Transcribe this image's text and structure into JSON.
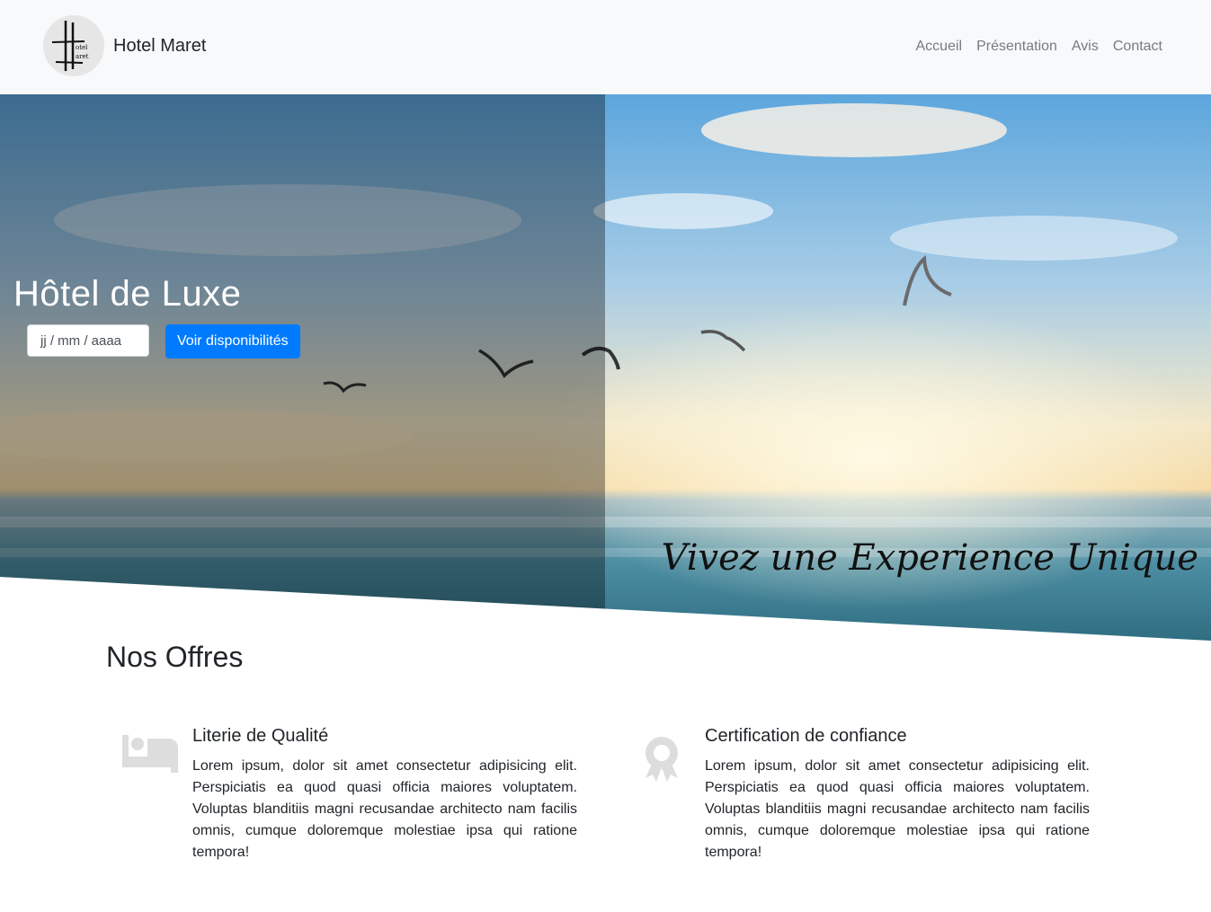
{
  "navbar": {
    "brand": "Hotel Maret",
    "logo_icon": "hotel-maret-logo",
    "links": [
      "Accueil",
      "Présentation",
      "Avis",
      "Contact"
    ]
  },
  "hero": {
    "title": "Hôtel de Luxe",
    "date_placeholder": "jj / mm / aaaa",
    "button": "Voir disponibilités",
    "tagline": "Vivez une Experience Unique"
  },
  "offers": {
    "title": "Nos Offres",
    "items": [
      {
        "icon": "bed-icon",
        "title": "Literie de Qualité",
        "text": "Lorem ipsum, dolor sit amet consectetur adipisicing elit. Perspiciatis ea quod quasi officia maiores voluptatem. Voluptas blanditiis magni recusandae architecto nam facilis omnis, cumque doloremque molestiae ipsa qui ratione tempora!"
      },
      {
        "icon": "award-icon",
        "title": "Certification de confiance",
        "text": "Lorem ipsum, dolor sit amet consectetur adipisicing elit. Perspiciatis ea quod quasi officia maiores voluptatem. Voluptas blanditiis magni recusandae architecto nam facilis omnis, cumque doloremque molestiae ipsa qui ratione tempora!"
      }
    ]
  },
  "colors": {
    "navbar_bg": "#f8f9fa",
    "primary": "#007bff",
    "nav_link": "#777b7f",
    "icon_gray": "#dddddd"
  }
}
